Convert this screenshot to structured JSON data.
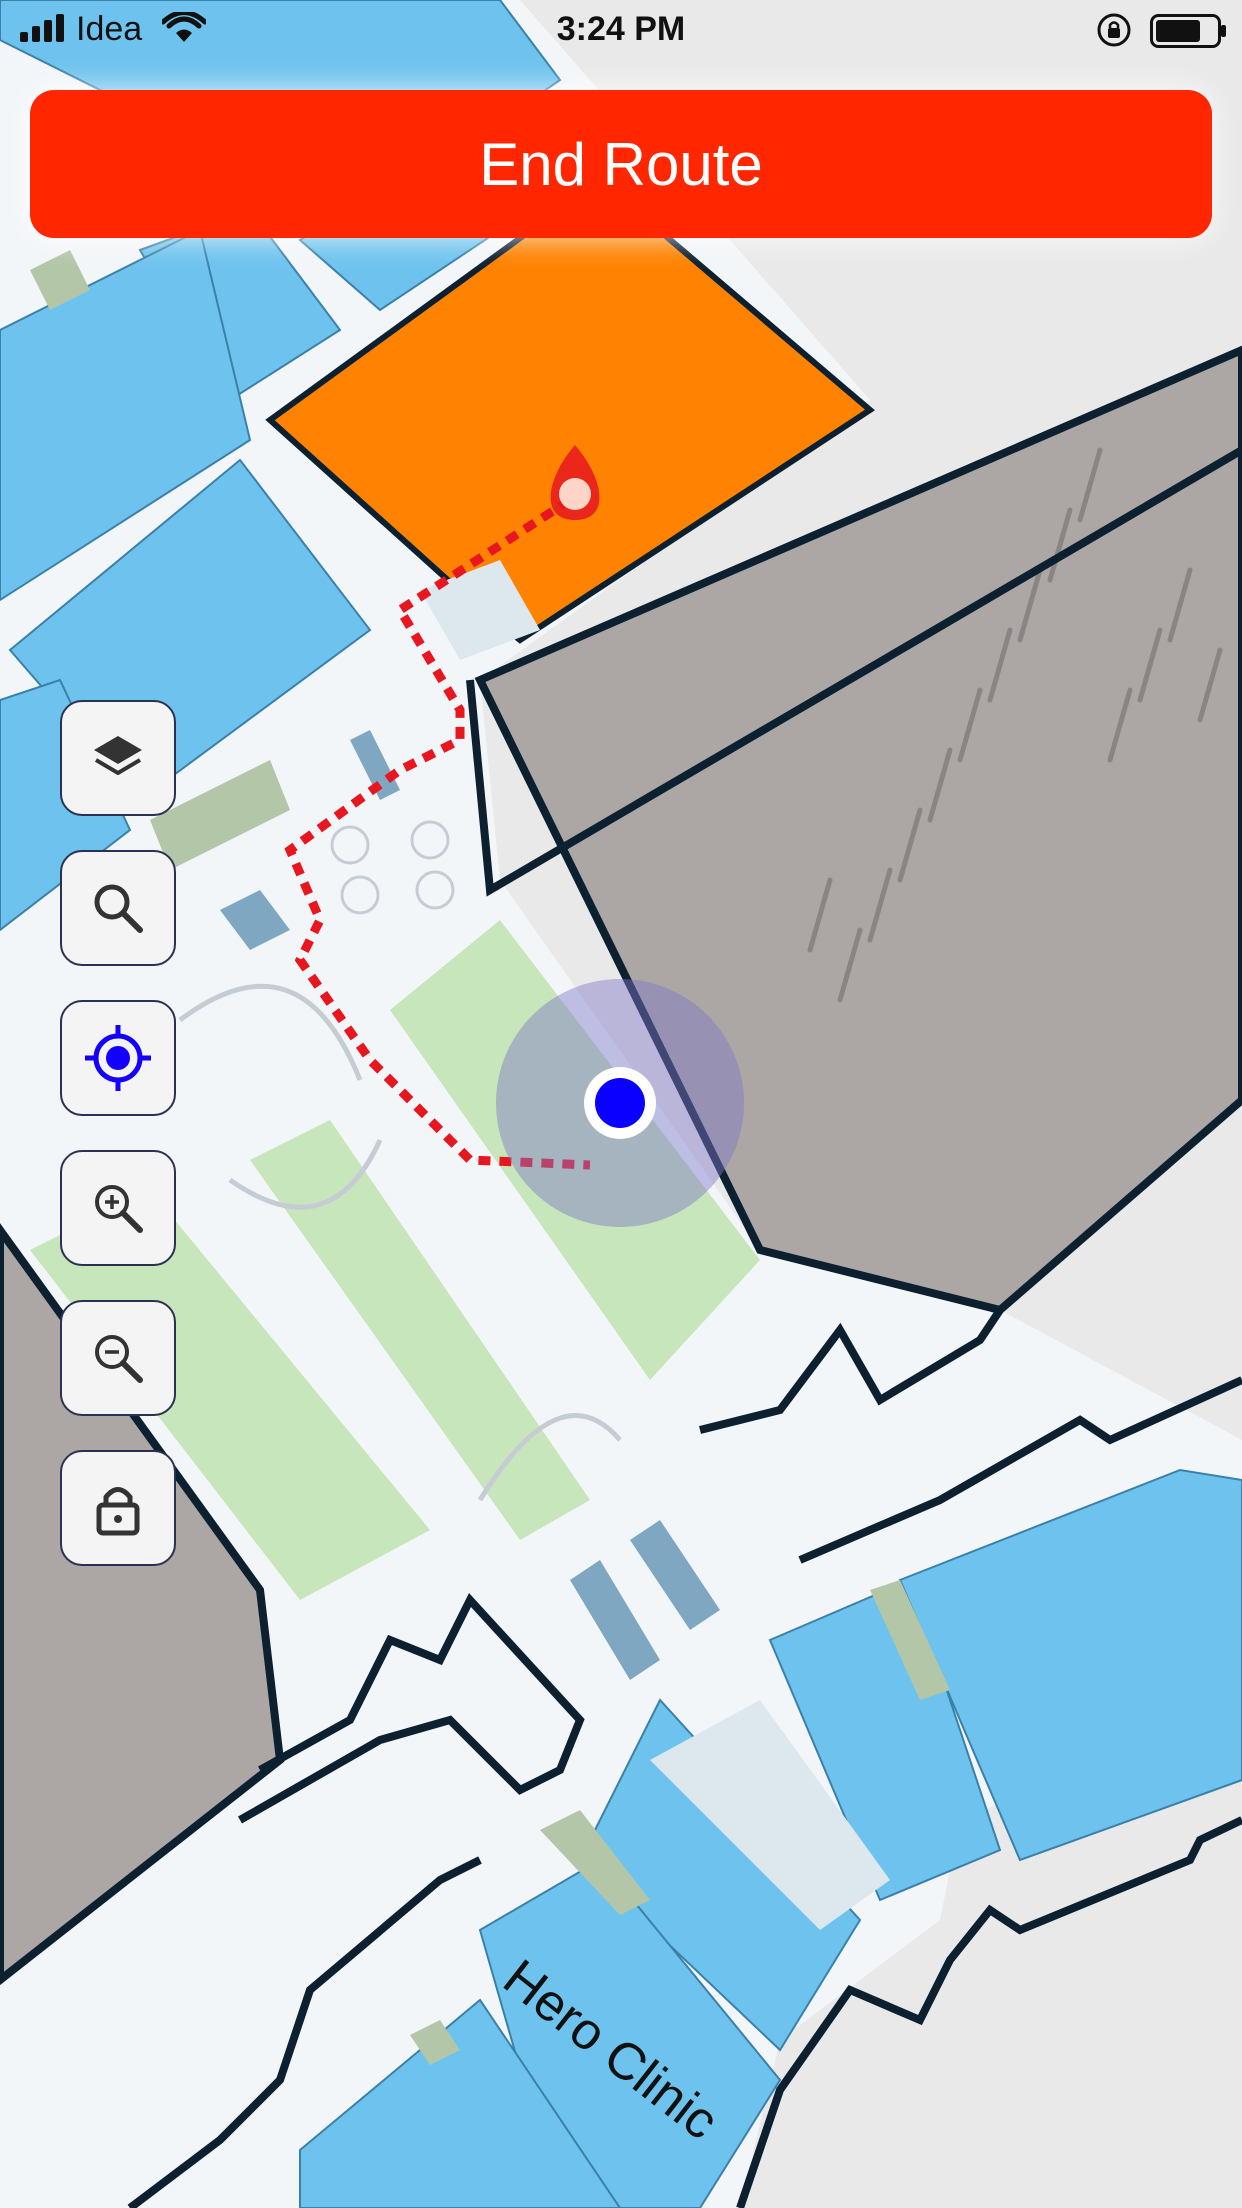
{
  "status_bar": {
    "carrier": "Idea",
    "time": "3:24 PM"
  },
  "route_button": {
    "label": "End Route",
    "color": "#ff2600"
  },
  "map_controls": [
    {
      "name": "layers",
      "icon": "layers-icon"
    },
    {
      "name": "search",
      "icon": "search-icon"
    },
    {
      "name": "my-location",
      "icon": "crosshair-icon"
    },
    {
      "name": "zoom-in",
      "icon": "zoom-in-icon"
    },
    {
      "name": "zoom-out",
      "icon": "zoom-out-icon"
    },
    {
      "name": "lock",
      "icon": "lock-icon"
    }
  ],
  "map": {
    "place_label": "Hero Clinic",
    "colors": {
      "destination": "#ff8200",
      "store": "#6ec3ee",
      "parking": "#aca6a5",
      "green": "#c7e6bb",
      "walkway": "#f3f6f9",
      "route": "#e8161e",
      "user_dot": "#0a00ff"
    }
  }
}
